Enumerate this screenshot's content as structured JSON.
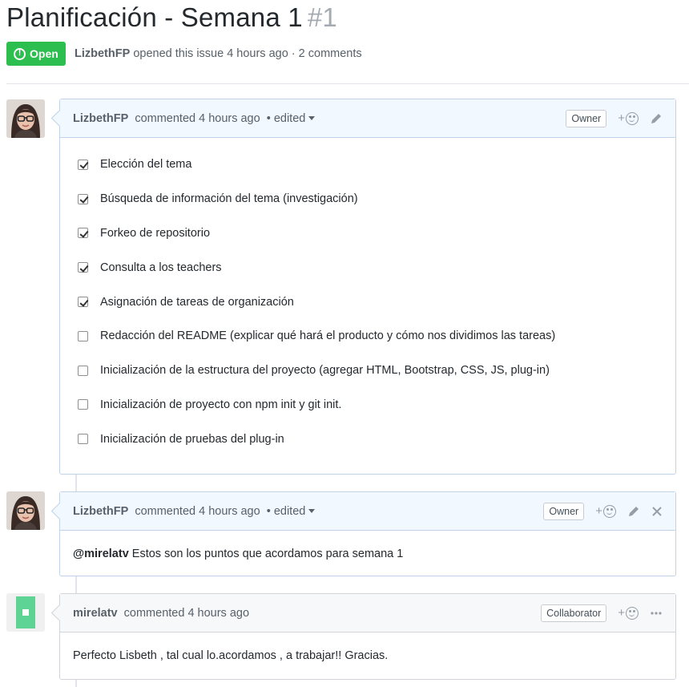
{
  "issue": {
    "title": "Planificación - Semana 1",
    "number": "#1",
    "state": "Open",
    "author": "LizbethFP",
    "meta_text": "opened this issue 4 hours ago · 2 comments"
  },
  "comments": [
    {
      "author": "LizbethFP",
      "action": "commented 4 hours ago",
      "edited": "• edited",
      "role": "Owner",
      "tasks": [
        {
          "label": "Elección del tema",
          "checked": true
        },
        {
          "label": "Búsqueda de información del tema (investigación)",
          "checked": true
        },
        {
          "label": "Forkeo de repositorio",
          "checked": true
        },
        {
          "label": "Consulta a los teachers",
          "checked": true
        },
        {
          "label": "Asignación de tareas de organización",
          "checked": true
        },
        {
          "label": "Redacción del README (explicar qué hará el producto y cómo nos dividimos las tareas)",
          "checked": false
        },
        {
          "label": "Inicialización de la estructura del proyecto (agregar HTML, Bootstrap, CSS, JS, plug-in)",
          "checked": false
        },
        {
          "label": "Inicialización de proyecto con npm init y git init.",
          "checked": false
        },
        {
          "label": "Inicialización de pruebas del plug-in",
          "checked": false
        }
      ]
    },
    {
      "author": "LizbethFP",
      "action": "commented 4 hours ago",
      "edited": "• edited",
      "role": "Owner",
      "mention": "@mirelatv",
      "body": "Estos son los puntos que acordamos para semana 1"
    },
    {
      "author": "mirelatv",
      "action": "commented 4 hours ago",
      "role": "Collaborator",
      "body": "Perfecto Lisbeth , tal cual lo.acordamos , a trabajar!! Gracias."
    }
  ],
  "icons": {
    "reaction": "add-reaction-icon",
    "edit": "pencil-icon",
    "delete": "close-icon",
    "more": "kebab-icon"
  },
  "colors": {
    "open_state": "#2cbe4e",
    "owner_header": "#f1f8ff",
    "plain_header": "#f6f8fa",
    "identicon": "#5fd394"
  }
}
